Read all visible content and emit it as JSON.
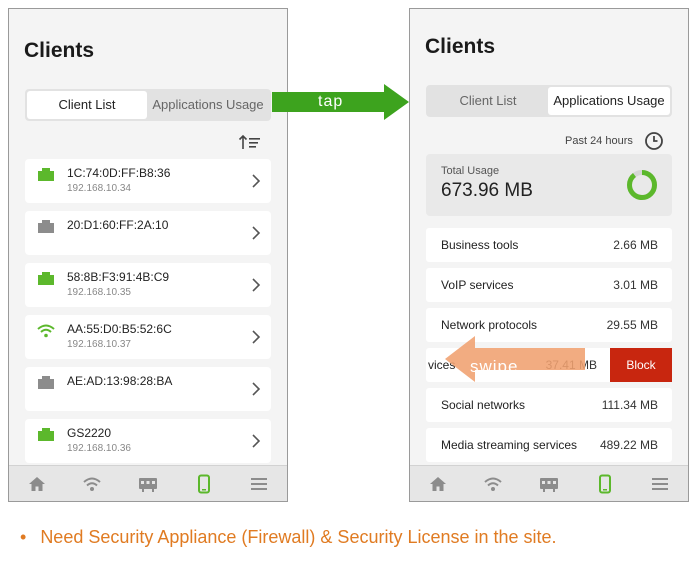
{
  "left_screen": {
    "title": "Clients",
    "tabs": [
      {
        "label": "Client List",
        "active": true
      },
      {
        "label": "Applications Usage",
        "active": false
      }
    ],
    "sort_icon": "sort-ascending-icon",
    "clients": [
      {
        "name": "1C:74:0D:FF:B8:36",
        "ip": "192.168.10.34",
        "icon": "ethernet-icon",
        "status_color": "#5cb82c"
      },
      {
        "name": "20:D1:60:FF:2A:10",
        "ip": "",
        "icon": "ethernet-icon",
        "status_color": "#8c8c8c"
      },
      {
        "name": "58:8B:F3:91:4B:C9",
        "ip": "192.168.10.35",
        "icon": "ethernet-icon",
        "status_color": "#5cb82c"
      },
      {
        "name": "AA:55:D0:B5:52:6C",
        "ip": "192.168.10.37",
        "icon": "wifi-icon",
        "status_color": "#5cb82c"
      },
      {
        "name": "AE:AD:13:98:28:BA",
        "ip": "",
        "icon": "ethernet-icon",
        "status_color": "#8c8c8c"
      },
      {
        "name": "GS2220",
        "ip": "192.168.10.36",
        "icon": "ethernet-icon",
        "status_color": "#5cb82c"
      }
    ]
  },
  "right_screen": {
    "title": "Clients",
    "tabs": [
      {
        "label": "Client List",
        "active": false
      },
      {
        "label": "Applications Usage",
        "active": true
      }
    ],
    "time_range": "Past 24 hours",
    "total_usage_label": "Total Usage",
    "total_usage_value": "673.96 MB",
    "apps": [
      {
        "name": "Business tools",
        "value": "2.66 MB"
      },
      {
        "name": "VoIP services",
        "value": "3.01 MB"
      },
      {
        "name": "Network protocols",
        "value": "29.55 MB"
      },
      {
        "name": "vices",
        "value": "37.41 MB"
      },
      {
        "name": "Social networks",
        "value": "111.34 MB"
      },
      {
        "name": "Media streaming services",
        "value": "489.22 MB"
      }
    ],
    "block_label": "Block"
  },
  "nav_items": [
    "home-icon",
    "wifi-icon",
    "switch-icon",
    "mobile-icon",
    "menu-icon"
  ],
  "nav_active_index": 3,
  "annotations": {
    "tap": "tap",
    "swipe": "swipe"
  },
  "footer_note": "Need Security Appliance (Firewall) & Security License in the site.",
  "colors": {
    "accent_green": "#5cb82c",
    "arrow_green": "#3da31e",
    "block_red": "#c8260f",
    "swipe_orange": "#f0a070",
    "note_orange": "#e07b22",
    "icon_gray": "#8c8c8c"
  }
}
